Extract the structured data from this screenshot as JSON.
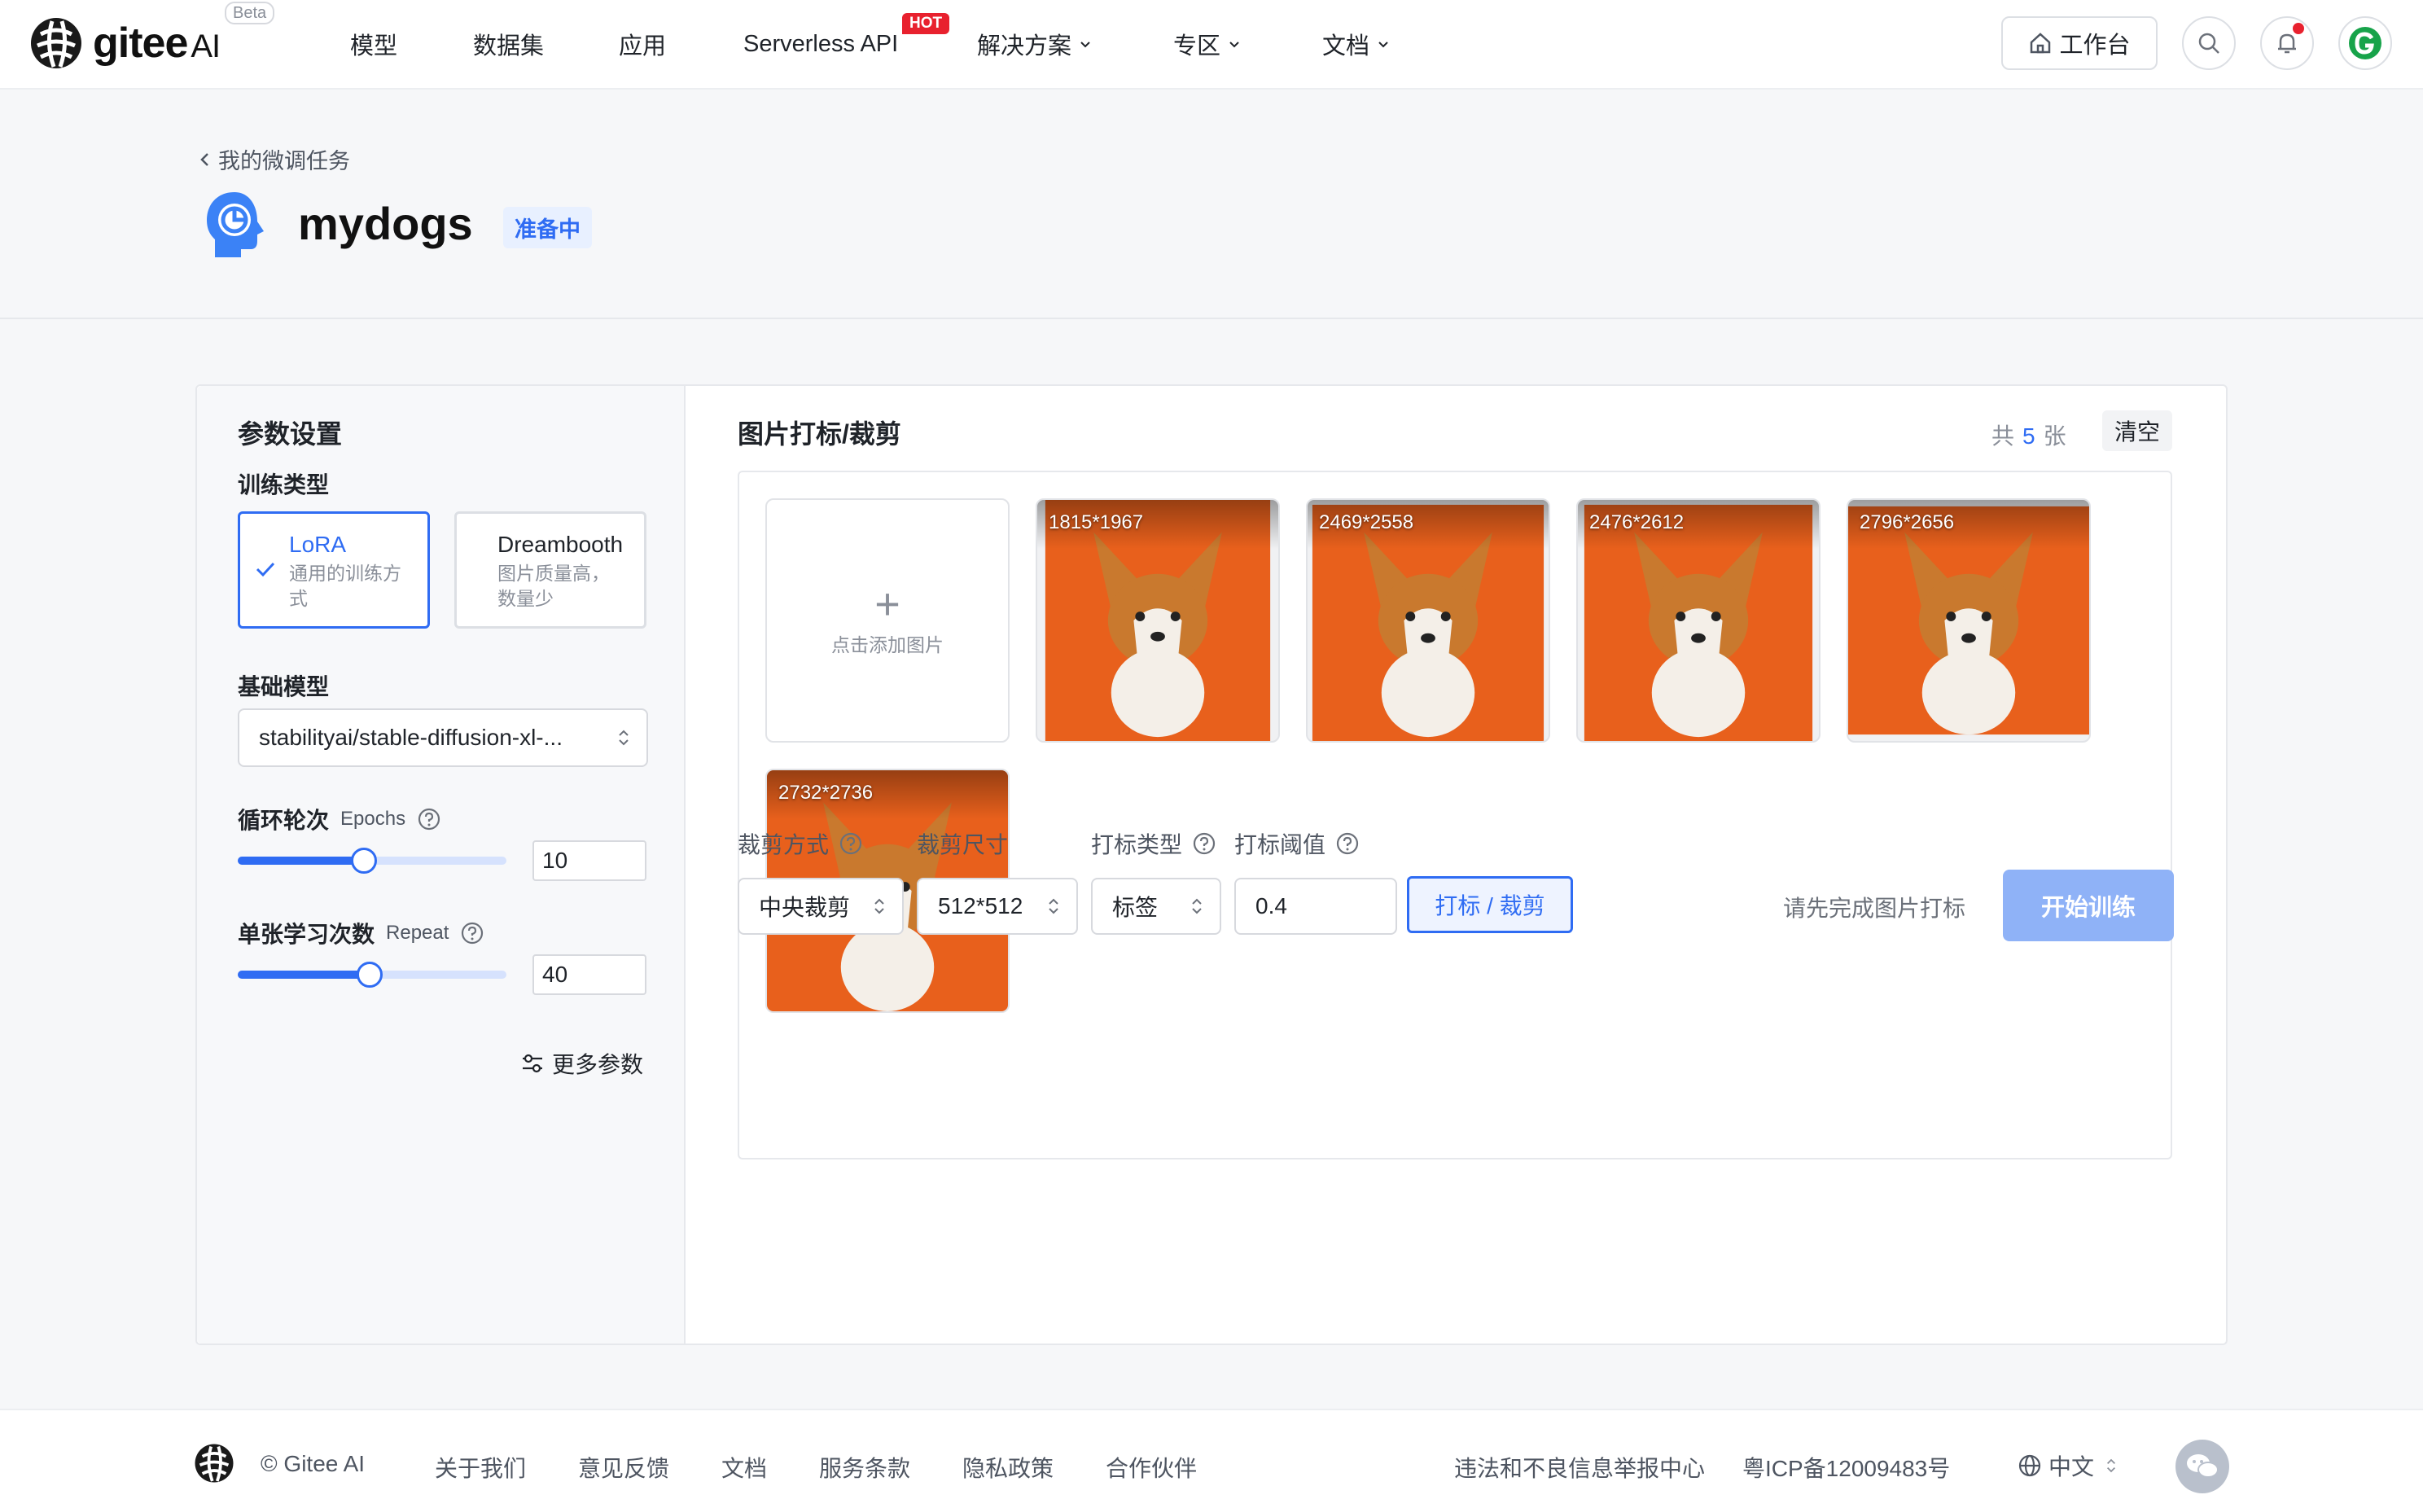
{
  "nav": {
    "logo_text": "gitee",
    "logo_ai": "AI",
    "beta": "Beta",
    "items": [
      {
        "label": "模型"
      },
      {
        "label": "数据集"
      },
      {
        "label": "应用"
      },
      {
        "label": "Serverless API",
        "badge": "HOT"
      },
      {
        "label": "解决方案"
      },
      {
        "label": "专区"
      },
      {
        "label": "文档"
      }
    ],
    "workbench_label": "工作台",
    "icons": [
      "home-icon",
      "search-icon",
      "bell-icon",
      "avatar"
    ]
  },
  "header": {
    "back_label": "我的微调任务",
    "title": "mydogs",
    "status": "准备中"
  },
  "params": {
    "title": "参数设置",
    "train_type_label": "训练类型",
    "train_types": [
      {
        "name": "LoRA",
        "desc": "通用的训练方式",
        "selected": true
      },
      {
        "name": "Dreambooth",
        "desc": "图片质量高，数量少",
        "selected": false
      }
    ],
    "base_model_label": "基础模型",
    "base_model_value": "stabilityai/stable-diffusion-xl-...",
    "epochs_label": "循环轮次",
    "epochs_en": "Epochs",
    "epochs_value": "10",
    "epochs_level": 0.47,
    "repeat_label": "单张学习次数",
    "repeat_en": "Repeat",
    "repeat_value": "40",
    "repeat_level": 0.49,
    "more_label": "更多参数"
  },
  "images": {
    "title": "图片打标/裁剪",
    "count_prefix": "共",
    "count": "5",
    "count_suffix": "张",
    "clear_label": "清空",
    "add_label": "点击添加图片",
    "items": [
      {
        "size": "1815*1967"
      },
      {
        "size": "2469*2558"
      },
      {
        "size": "2476*2612"
      },
      {
        "size": "2796*2656"
      },
      {
        "size": "2732*2736"
      }
    ]
  },
  "controls": {
    "crop_mode_label": "裁剪方式",
    "crop_mode_value": "中央裁剪",
    "crop_size_label": "裁剪尺寸",
    "crop_size_value": "512*512",
    "tag_type_label": "打标类型",
    "tag_type_value": "标签",
    "threshold_label": "打标阈值",
    "threshold_value": "0.4",
    "tag_crop_button": "打标 / 裁剪",
    "hint": "请先完成图片打标",
    "start_button": "开始训练"
  },
  "footer": {
    "copyright": "© Gitee AI",
    "links": [
      "关于我们",
      "意见反馈",
      "文档",
      "服务条款",
      "隐私政策",
      "合作伙伴"
    ],
    "report": "违法和不良信息举报中心",
    "icp": "粤ICP备12009483号",
    "lang": "中文"
  },
  "colors": {
    "accent": "#2f6cf3",
    "hot": "#e8212e",
    "photo_bg": "#e8601c",
    "start_disabled": "#8fb2f7"
  }
}
